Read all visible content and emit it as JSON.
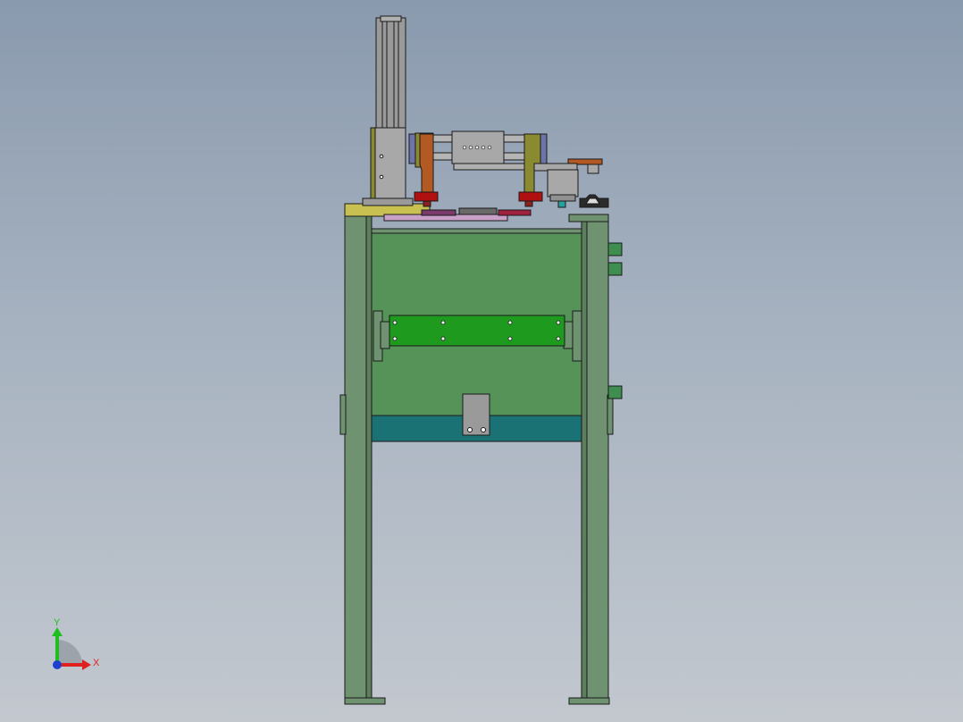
{
  "viewport": {
    "background_top": "#8a9aae",
    "background_bottom": "#c3c8cf"
  },
  "colors": {
    "frame_green": "#6f9370",
    "panel_green": "#569358",
    "bracket_green": "#1e9a1e",
    "teal_base": "#1b7274",
    "steel_gray": "#9a9a9a",
    "olive": "#8a8a30",
    "copper": "#b35a24",
    "red_collar": "#b01010",
    "yellow_plate": "#c8c050",
    "pink_plate": "#c9a0c8",
    "outline": "#1a1a1a"
  },
  "triad": {
    "y_label": "Y",
    "x_label": "X",
    "y_color": "#1fbf1f",
    "x_color": "#e02020",
    "z_color": "#1f3fd0"
  },
  "icons": [
    "axis-triad-icon"
  ]
}
